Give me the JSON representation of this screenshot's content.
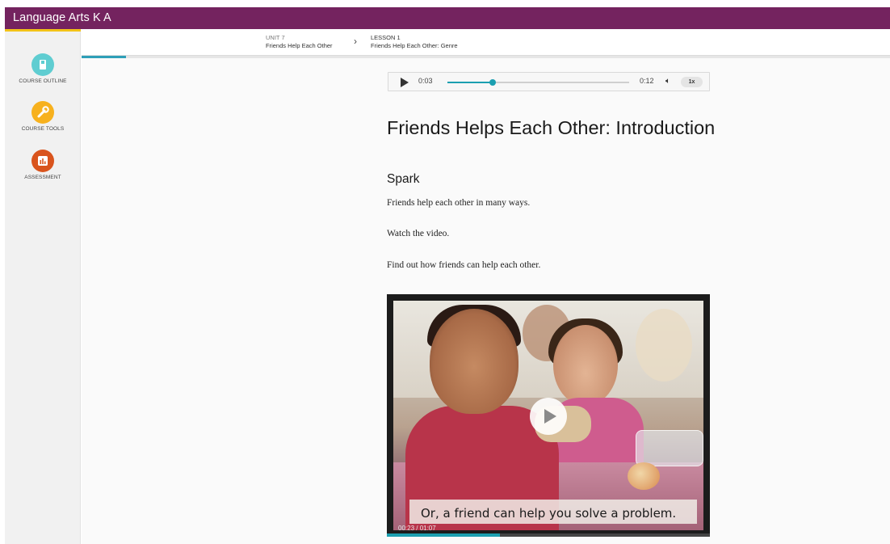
{
  "app": {
    "title": "Language Arts K A"
  },
  "sidebar": {
    "items": [
      {
        "label": "COURSE OUTLINE",
        "icon": "book-icon",
        "color": "#5fcdd1"
      },
      {
        "label": "COURSE TOOLS",
        "icon": "wrench-icon",
        "color": "#f7b11e"
      },
      {
        "label": "ASSESSMENT",
        "icon": "bar-chart-icon",
        "color": "#d9541d"
      }
    ]
  },
  "breadcrumb": {
    "unit_label": "UNIT 7",
    "unit_title": "Friends Help Each Other",
    "lesson_label": "LESSON 1",
    "lesson_title": "Friends Help Each Other: Genre"
  },
  "course_progress": 0.055,
  "audio": {
    "current": "0:03",
    "duration": "0:12",
    "speed": "1x",
    "progress": 0.25
  },
  "content": {
    "title": "Friends Helps Each Other: Introduction",
    "section": "Spark",
    "paragraphs": [
      "Friends help each other in many ways.",
      "Watch the video.",
      "Find out how friends can help each other."
    ]
  },
  "video": {
    "caption": "Or, a friend can help you solve a problem.",
    "time": "00:23 / 01:07",
    "progress": 0.35
  },
  "colors": {
    "brand": "#74235f",
    "accent": "#1b9fb0",
    "highlight": "#f2c318"
  }
}
